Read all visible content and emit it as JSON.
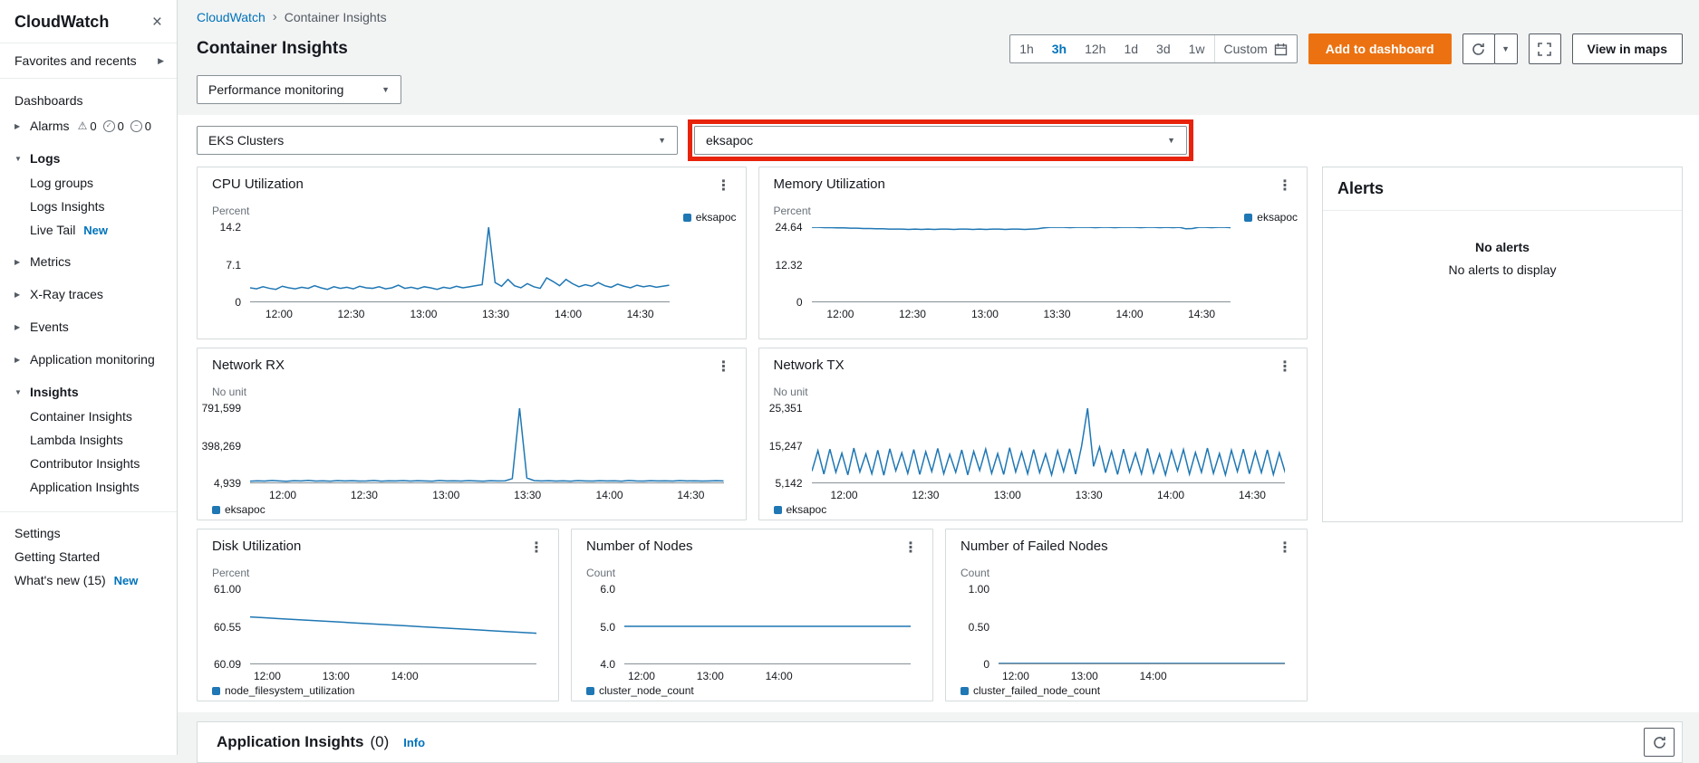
{
  "app": {
    "accent_blue": "#0073bb",
    "line_color": "#1f77b4",
    "orange": "#ec7211",
    "annotation_red": "#e8230c"
  },
  "sidebar": {
    "title": "CloudWatch",
    "favorites_label": "Favorites and recents",
    "dashboards_label": "Dashboards",
    "alarms": {
      "label": "Alarms",
      "warning_count": "0",
      "ok_count": "0",
      "insufficient_count": "0"
    },
    "logs": {
      "label": "Logs",
      "items": [
        "Log groups",
        "Logs Insights"
      ],
      "live_tail_label": "Live Tail",
      "live_tail_badge": "New"
    },
    "metrics_label": "Metrics",
    "xray_label": "X-Ray traces",
    "events_label": "Events",
    "app_monitoring_label": "Application monitoring",
    "insights": {
      "label": "Insights",
      "items": [
        "Container Insights",
        "Lambda Insights",
        "Contributor Insights",
        "Application Insights"
      ]
    },
    "settings_label": "Settings",
    "getting_started_label": "Getting Started",
    "whats_new_label": "What's new (15)",
    "whats_new_badge": "New"
  },
  "breadcrumb": {
    "root": "CloudWatch",
    "separator": "›",
    "current": "Container Insights"
  },
  "page": {
    "title": "Container Insights"
  },
  "toolbar": {
    "ranges": [
      "1h",
      "3h",
      "12h",
      "1d",
      "3d",
      "1w"
    ],
    "selected_range": "3h",
    "custom_label": "Custom",
    "add_to_dashboard_label": "Add to dashboard",
    "view_in_maps_label": "View in maps"
  },
  "filters": {
    "view_dropdown_value": "Performance monitoring",
    "cluster_type_value": "EKS Clusters",
    "cluster_value": "eksapoc"
  },
  "alerts_panel": {
    "title": "Alerts",
    "empty_title": "No alerts",
    "empty_message": "No alerts to display"
  },
  "app_insights": {
    "title": "Application Insights",
    "count": "(0)",
    "info_label": "Info"
  },
  "charts": [
    {
      "title": "CPU Utilization",
      "unit": "Percent",
      "legend": "eksapoc",
      "legend_position": "top-right",
      "yticks": [
        "14.2",
        "7.1",
        "0"
      ],
      "ymin": 0,
      "ymax": 14.2,
      "xticks": [
        "12:00",
        "12:30",
        "13:00",
        "13:30",
        "14:00",
        "14:30"
      ],
      "xtick_pos": [
        6.9,
        24.1,
        41.4,
        58.6,
        75.9,
        93.1
      ],
      "values": [
        2.6,
        2.4,
        2.8,
        2.5,
        2.3,
        2.9,
        2.6,
        2.4,
        2.7,
        2.5,
        3.0,
        2.6,
        2.3,
        2.8,
        2.5,
        2.7,
        2.4,
        2.9,
        2.6,
        2.5,
        2.8,
        2.4,
        2.6,
        3.1,
        2.5,
        2.7,
        2.4,
        2.8,
        2.6,
        2.3,
        2.7,
        2.5,
        2.9,
        2.6,
        2.8,
        3.0,
        3.2,
        14.2,
        3.6,
        2.9,
        4.2,
        3.0,
        2.6,
        3.4,
        2.8,
        2.5,
        4.5,
        3.8,
        3.0,
        4.2,
        3.4,
        2.8,
        3.2,
        2.9,
        3.6,
        3.0,
        2.7,
        3.3,
        2.9,
        2.6,
        3.1,
        2.8,
        3.0,
        2.7,
        2.9,
        3.1
      ]
    },
    {
      "title": "Memory Utilization",
      "unit": "Percent",
      "legend": "eksapoc",
      "legend_position": "top-right",
      "yticks": [
        "24.64",
        "12.32",
        "0"
      ],
      "ymin": 0,
      "ymax": 24.64,
      "xticks": [
        "12:00",
        "12:30",
        "13:00",
        "13:30",
        "14:00",
        "14:30"
      ],
      "xtick_pos": [
        6.9,
        24.1,
        41.4,
        58.6,
        75.9,
        93.1
      ],
      "values": [
        24.6,
        24.6,
        24.5,
        24.5,
        24.4,
        24.4,
        24.3,
        24.3,
        24.2,
        24.2,
        24.1,
        24.1,
        24.0,
        24.0,
        24.0,
        23.9,
        24.0,
        23.9,
        24.0,
        23.9,
        24.0,
        24.0,
        23.9,
        24.0,
        24.0,
        23.9,
        24.0,
        23.9,
        24.0,
        24.0,
        23.9,
        24.0,
        24.0,
        23.9,
        24.0,
        24.1,
        24.4,
        24.6,
        24.6,
        24.6,
        24.5,
        24.6,
        24.6,
        24.6,
        24.5,
        24.6,
        24.6,
        24.5,
        24.6,
        24.6,
        24.6,
        24.5,
        24.6,
        24.6,
        24.5,
        24.6,
        24.5,
        24.6,
        24.1,
        24.2,
        24.6,
        24.6,
        24.5,
        24.6,
        24.6,
        24.5
      ]
    },
    {
      "title": "Network RX",
      "unit": "No unit",
      "legend": "eksapoc",
      "legend_position": "bottom-left",
      "yticks": [
        "791,599",
        "398,269",
        "4,939"
      ],
      "ymin": 4939,
      "ymax": 791599,
      "xticks": [
        "12:00",
        "12:30",
        "13:00",
        "13:30",
        "14:00",
        "14:30"
      ],
      "xtick_pos": [
        6.9,
        24.1,
        41.4,
        58.6,
        75.9,
        93.1
      ],
      "values": [
        18000,
        22000,
        19000,
        25000,
        21000,
        17000,
        23000,
        20000,
        26000,
        19000,
        22000,
        18000,
        24000,
        20000,
        23000,
        19000,
        21000,
        25000,
        18000,
        22000,
        20000,
        24000,
        19000,
        23000,
        21000,
        18000,
        25000,
        20000,
        22000,
        19000,
        24000,
        21000,
        18000,
        23000,
        20000,
        22000,
        45000,
        791599,
        52000,
        24000,
        20000,
        23000,
        19000,
        22000,
        18000,
        24000,
        21000,
        19000,
        23000,
        20000,
        22000,
        18000,
        25000,
        21000,
        19000,
        23000,
        20000,
        22000,
        19000,
        24000,
        20000,
        22000,
        19000,
        21000,
        23000,
        20000
      ]
    },
    {
      "title": "Network TX",
      "unit": "No unit",
      "legend": "eksapoc",
      "legend_position": "bottom-left",
      "yticks": [
        "25,351",
        "15,247",
        "5,142"
      ],
      "ymin": 5142,
      "ymax": 25351,
      "xticks": [
        "12:00",
        "12:30",
        "13:00",
        "13:30",
        "14:00",
        "14:30"
      ],
      "xtick_pos": [
        6.9,
        24.1,
        41.4,
        58.6,
        75.9,
        93.1
      ],
      "values": [
        8200,
        13800,
        7400,
        14200,
        7900,
        13100,
        7200,
        14500,
        8000,
        12900,
        7500,
        13900,
        7100,
        14300,
        8300,
        13200,
        7600,
        14100,
        7300,
        13500,
        8100,
        14400,
        7500,
        12800,
        7900,
        14000,
        7200,
        13600,
        8400,
        14200,
        7600,
        13000,
        7300,
        14600,
        8000,
        13400,
        7500,
        14100,
        7800,
        12900,
        7200,
        13800,
        8100,
        14300,
        7400,
        15000,
        25351,
        9500,
        14800,
        7800,
        13600,
        7300,
        14200,
        8000,
        13100,
        7500,
        14400,
        7700,
        12900,
        7200,
        13800,
        8300,
        14100,
        7400,
        13300,
        7900,
        14500,
        7600,
        13000,
        7200,
        13900,
        8100,
        14200,
        7500,
        13500,
        7800,
        14000,
        7300,
        13200,
        7700
      ]
    },
    {
      "title": "Disk Utilization",
      "unit": "Percent",
      "legend": "node_filesystem_utilization",
      "legend_position": "bottom-left",
      "yticks": [
        "61.00",
        "60.55",
        "60.09"
      ],
      "ymin": 60.09,
      "ymax": 61.0,
      "xticks": [
        "12:00",
        "13:00",
        "14:00"
      ],
      "xtick_pos": [
        6,
        30,
        54
      ],
      "values": [
        60.66,
        60.65,
        60.64,
        60.63,
        60.62,
        60.61,
        60.6,
        60.59,
        60.58,
        60.57,
        60.56,
        60.55,
        60.54,
        60.53,
        60.52,
        60.51,
        60.5,
        60.49,
        60.48,
        60.47,
        60.46
      ]
    },
    {
      "title": "Number of Nodes",
      "unit": "Count",
      "legend": "cluster_node_count",
      "legend_position": "bottom-left",
      "yticks": [
        "6.0",
        "5.0",
        "4.0"
      ],
      "ymin": 4,
      "ymax": 6,
      "xticks": [
        "12:00",
        "13:00",
        "14:00"
      ],
      "xtick_pos": [
        6,
        30,
        54
      ],
      "values": [
        5,
        5,
        5,
        5,
        5,
        5,
        5,
        5,
        5,
        5,
        5,
        5,
        5,
        5,
        5,
        5,
        5,
        5,
        5,
        5,
        5
      ]
    },
    {
      "title": "Number of Failed Nodes",
      "unit": "Count",
      "legend": "cluster_failed_node_count",
      "legend_position": "bottom-left",
      "yticks": [
        "1.00",
        "0.50",
        "0"
      ],
      "ymin": 0,
      "ymax": 1,
      "xticks": [
        "12:00",
        "13:00",
        "14:00"
      ],
      "xtick_pos": [
        6,
        30,
        54
      ],
      "values": [
        0,
        0,
        0,
        0,
        0,
        0,
        0,
        0,
        0,
        0,
        0,
        0,
        0,
        0,
        0,
        0,
        0,
        0,
        0,
        0,
        0
      ]
    }
  ]
}
